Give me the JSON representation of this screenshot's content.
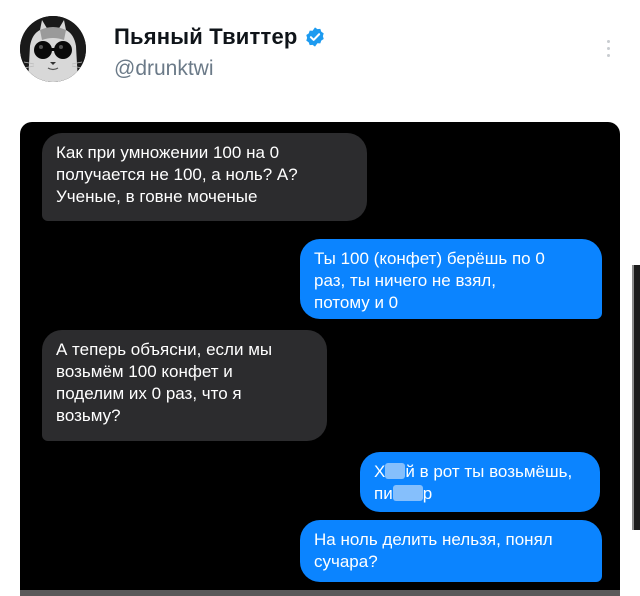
{
  "account": {
    "display_name": "Пьяный Твиттер",
    "handle": "@drunktwi",
    "verified": true,
    "avatar_icon": "cat-with-sunglasses-avatar",
    "verified_color": "#1d9bf0"
  },
  "menu": {
    "icon": "vertical-ellipsis-icon"
  },
  "messages": [
    {
      "side": "incoming",
      "lines": [
        "Как при умножении 100 на 0",
        "получается не 100, а ноль? А?",
        "Ученые, в говне моченые"
      ]
    },
    {
      "side": "outgoing",
      "lines": [
        "Ты 100 (конфет) берёшь по 0",
        "раз, ты ничего не взял,",
        "потому и 0"
      ]
    },
    {
      "side": "incoming",
      "lines": [
        "А теперь объясни, если мы",
        "возьмём 100 конфет и",
        "поделим их 0 раз, что я",
        "возьму?"
      ]
    },
    {
      "side": "outgoing",
      "lines": [
        "Х й в рот ты возьмёшь,",
        "пи  р"
      ],
      "censored": true
    },
    {
      "side": "outgoing",
      "lines": [
        "На ноль делить нельзя, понял",
        "сучара?"
      ]
    }
  ],
  "colors": {
    "incoming_bubble": "#2c2c2e",
    "outgoing_bubble": "#0b84ff",
    "chat_background": "#000000"
  }
}
